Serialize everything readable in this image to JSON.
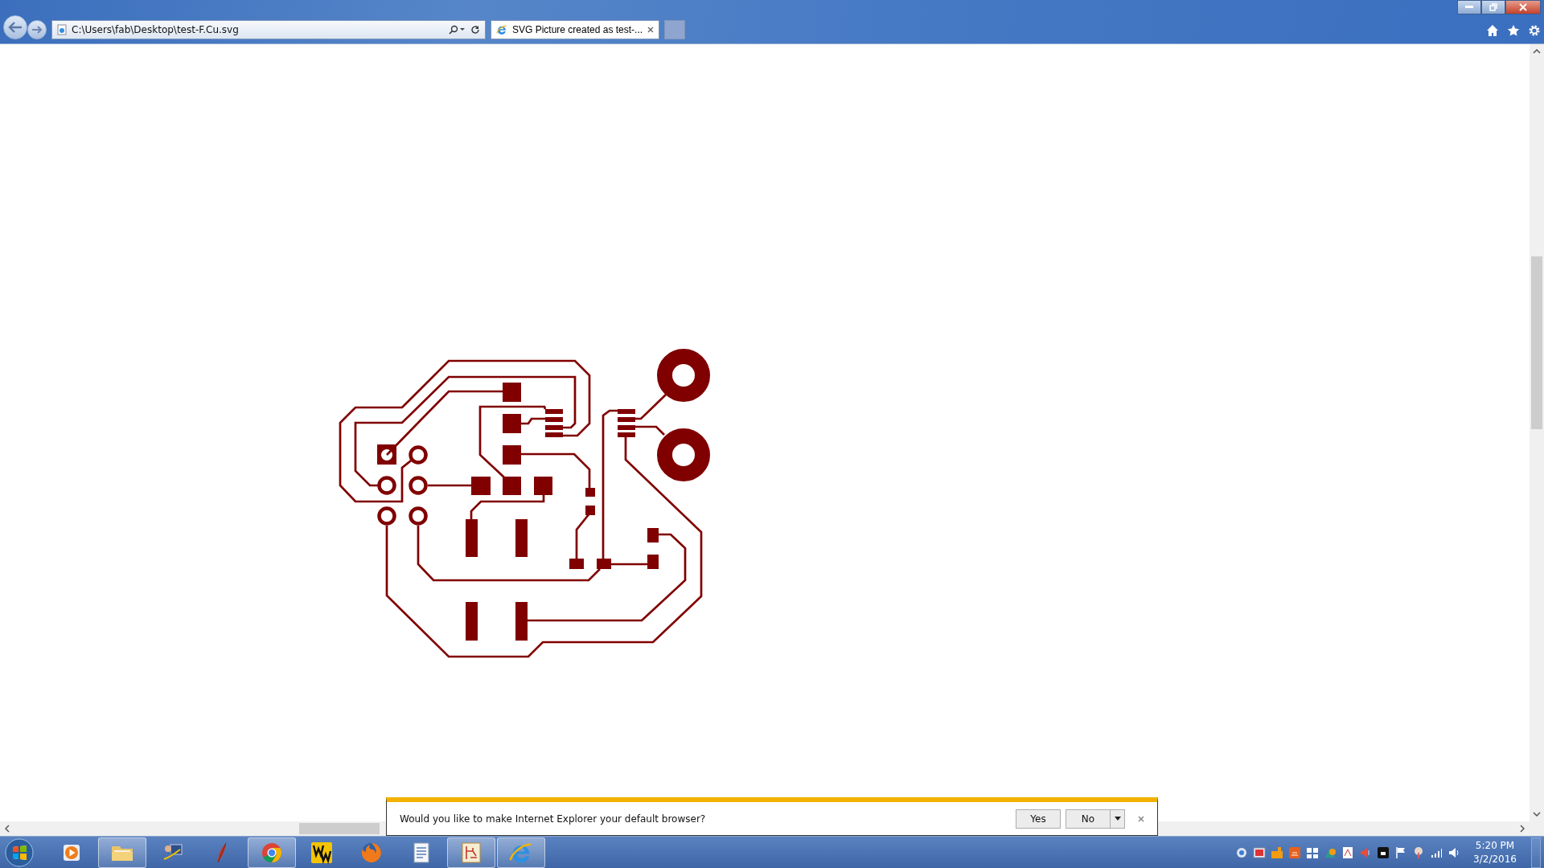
{
  "address_bar": {
    "url": "C:\\Users\\fab\\Desktop\\test-F.Cu.svg"
  },
  "tabs": [
    {
      "title": "SVG Picture created as test-...",
      "selected": true
    }
  ],
  "notification": {
    "message": "Would you like to make Internet Explorer your default browser?",
    "buttons": [
      "Yes",
      "No"
    ]
  },
  "taskbar": {
    "apps": [
      {
        "kind": "media",
        "running": false
      },
      {
        "kind": "folder",
        "running": true
      },
      {
        "kind": "desk",
        "running": false
      },
      {
        "kind": "feather",
        "running": false
      },
      {
        "kind": "chrome",
        "running": true
      },
      {
        "kind": "mw",
        "running": false
      },
      {
        "kind": "firefox",
        "running": false
      },
      {
        "kind": "document",
        "running": false
      },
      {
        "kind": "schematic",
        "running": true
      },
      {
        "kind": "ie",
        "running": true
      }
    ]
  },
  "clock": {
    "time": "5:20 PM",
    "date": "3/2/2016"
  }
}
